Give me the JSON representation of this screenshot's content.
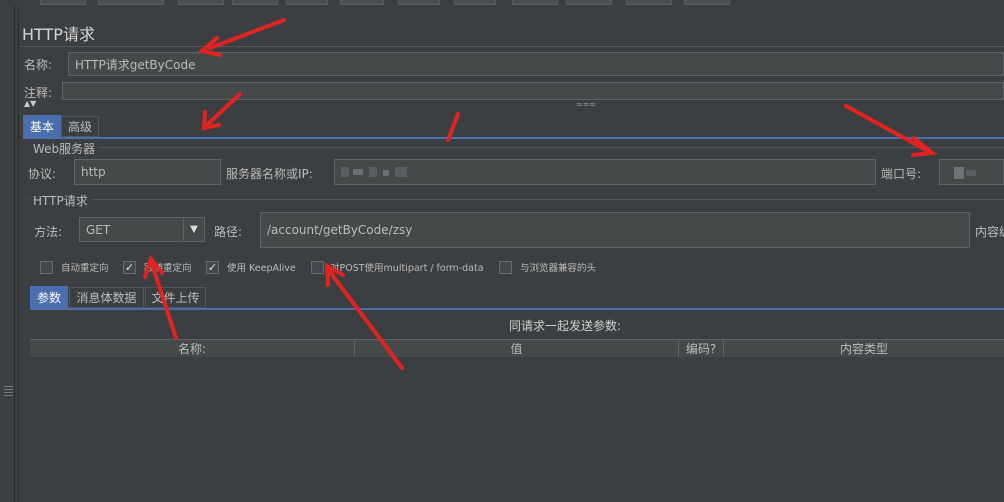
{
  "panel": {
    "title": "HTTP请求"
  },
  "name_field": {
    "label": "名称:",
    "value": "HTTP请求getByCode"
  },
  "comment_field": {
    "label": "注释:",
    "value": ""
  },
  "tabs": [
    {
      "label": "基本"
    },
    {
      "label": "高级"
    }
  ],
  "web_server": {
    "group_title": "Web服务器",
    "protocol_label": "协议:",
    "protocol_value": "http",
    "server_label": "服务器名称或IP:",
    "port_label": "端口号:"
  },
  "http_request": {
    "group_title": "HTTP请求",
    "method_label": "方法:",
    "method_value": "GET",
    "path_label": "路径:",
    "path_value": "/account/getByCode/zsy",
    "content_encoding_label": "内容编"
  },
  "options": [
    {
      "label": "自动重定向",
      "checked": false
    },
    {
      "label": "跟随重定向",
      "checked": true
    },
    {
      "label": "使用 KeepAlive",
      "checked": true
    },
    {
      "label": "对POST使用multipart / form-data",
      "checked": false
    },
    {
      "label": "与浏览器兼容的头",
      "checked": false
    }
  ],
  "sub_tabs": [
    {
      "label": "参数"
    },
    {
      "label": "消息体数据"
    },
    {
      "label": "文件上传"
    }
  ],
  "params": {
    "heading": "同请求一起发送参数:",
    "columns": [
      "名称:",
      "值",
      "编码?",
      "内容类型"
    ]
  },
  "colors": {
    "accent": "#4b6eaf",
    "annotation_arrow": "#e32222"
  }
}
